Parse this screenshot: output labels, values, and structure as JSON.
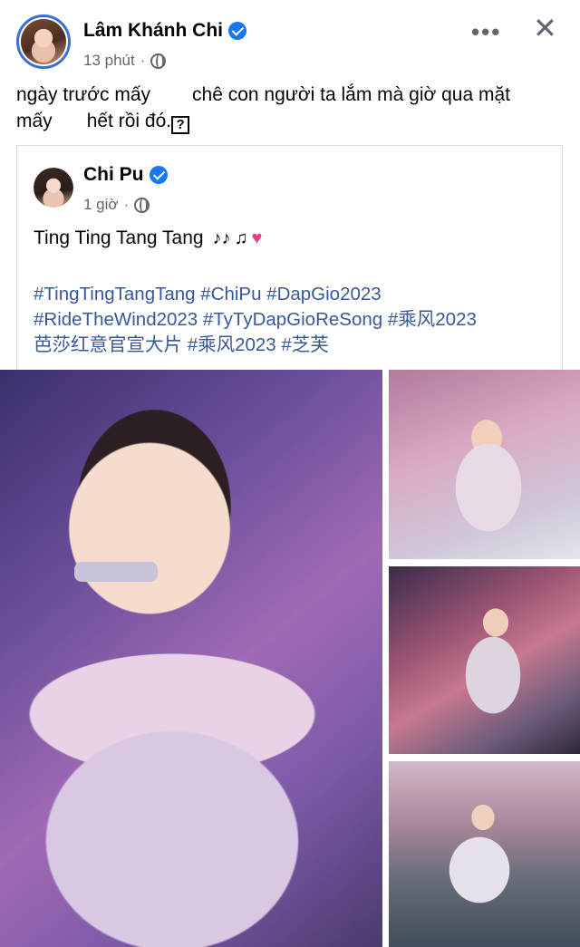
{
  "post": {
    "author": "Lâm Khánh Chi",
    "time": "13 phút",
    "separator": "·",
    "text_line1_a": "ngày trước mấy",
    "text_line1_b": "chê con người ta lắm mà giờ qua mặt",
    "text_line2_a": "mấy",
    "text_line2_b": "hết rồi đó.",
    "unknown_char": "?"
  },
  "shared": {
    "author": "Chi Pu",
    "time": "1 giờ",
    "separator": "·",
    "caption": "Ting Ting Tang Tang",
    "hashtags_line1": "#TingTingTangTang #ChiPu #DapGio2023",
    "hashtags_line2": "#RideTheWind2023 #TyTyDapGioReSong #乘风2023",
    "hashtags_line3": "芭莎红意官宣大片 #乘风2023 #芝芙"
  },
  "icons": {
    "verified": "verified-badge-icon",
    "globe": "public-globe-icon",
    "more": "more-options-icon",
    "close": "close-icon",
    "emoji": [
      "musical-notes-emoji",
      "music-note-emoji",
      "sparkling-heart-emoji"
    ]
  },
  "colors": {
    "link": "#385898",
    "verified": "#1877f2",
    "meta": "#65676b",
    "avatar_ring": "#3b6fd8"
  }
}
